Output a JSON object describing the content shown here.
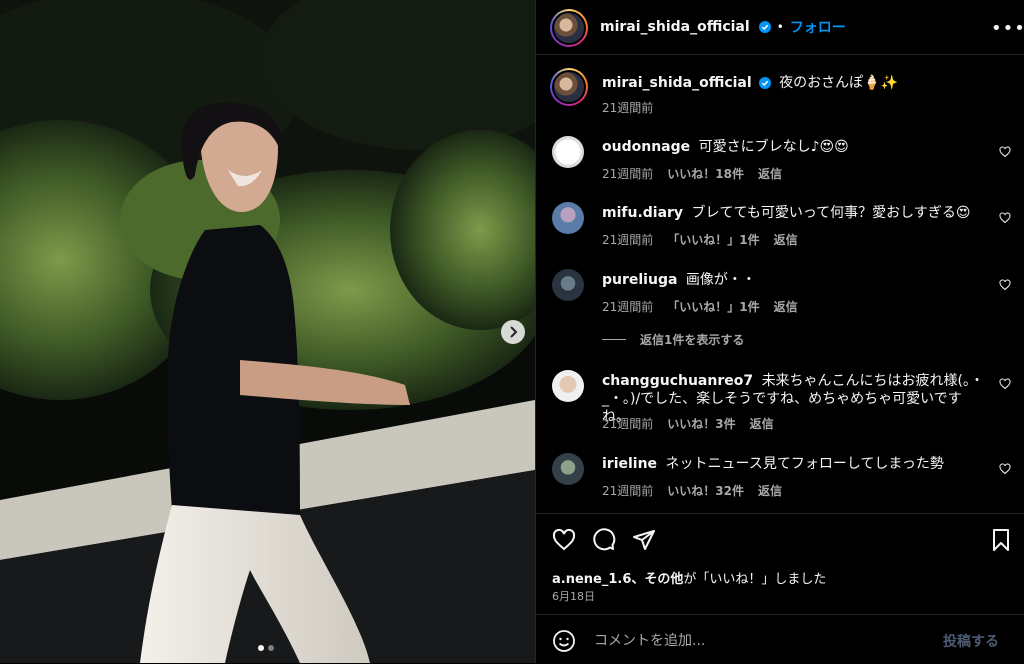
{
  "post": {
    "username": "mirai_shida_official",
    "follow_label": "フォロー",
    "separator": "•",
    "more_label": "•••",
    "caption": {
      "username": "mirai_shida_official",
      "text": "夜のおさんぽ🍦✨",
      "time": "21週間前"
    },
    "likes_prefix": "a.nene_1.6、",
    "likes_others": "その他",
    "likes_suffix": "が「いいね！」しました",
    "date": "6月18日"
  },
  "comments": [
    {
      "username": "oudonnage",
      "text": "可愛さにブレなし♪😍😍",
      "time": "21週間前",
      "likes": "いいね！18件",
      "reply": "返信"
    },
    {
      "username": "mifu.diary",
      "text": "ブレてても可愛いって何事？愛おしすぎる😍",
      "time": "21週間前",
      "likes": "「いいね！」1件",
      "reply": "返信"
    },
    {
      "username": "pureliuga",
      "text": "画像が・・",
      "time": "21週間前",
      "likes": "「いいね！」1件",
      "reply": "返信"
    },
    {
      "username": "changguchuanreo7",
      "text": "未来ちゃんこんにちはお疲れ様(｡・_・｡)/でした、楽しそうですね、めちゃめちゃ可愛いですね。",
      "time": "21週間前",
      "likes": "いいね！3件",
      "reply": "返信"
    },
    {
      "username": "irieline",
      "text": "ネットニュース見てフォローしてしまった勢",
      "time": "21週間前",
      "likes": "いいね！32件",
      "reply": "返信"
    }
  ],
  "view_replies": "返信1件を表示する",
  "add_comment": {
    "placeholder": "コメントを追加...",
    "post_label": "投稿する"
  },
  "carousel": {
    "total": 2,
    "current": 1
  },
  "colors": {
    "accent": "#0095f6",
    "background": "#000000",
    "secondary_text": "#a8a8a8"
  }
}
